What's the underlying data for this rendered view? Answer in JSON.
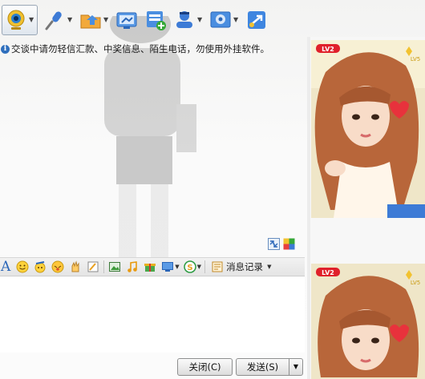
{
  "notice": {
    "text": "交谈中请勿轻信汇款、中奖信息、陌生电话，勿使用外挂软件。"
  },
  "toolbar": {
    "items": [
      {
        "icon": "webcam-icon",
        "has_dropdown": true
      },
      {
        "icon": "microphone-icon",
        "has_dropdown": true
      },
      {
        "icon": "folder-share-icon",
        "has_dropdown": true
      },
      {
        "icon": "screen-share-icon",
        "has_dropdown": false
      },
      {
        "icon": "add-app-icon",
        "has_dropdown": false
      },
      {
        "icon": "group-chat-icon",
        "has_dropdown": true
      },
      {
        "icon": "settings-icon",
        "has_dropdown": true
      },
      {
        "icon": "remote-assist-icon",
        "has_dropdown": false
      }
    ]
  },
  "format_toolbar": {
    "font_glyph": "A",
    "history_label": "消息记录"
  },
  "actions": {
    "close_label": "关闭(C)",
    "send_label": "发送(S)",
    "send_dropdown_glyph": "▼"
  },
  "profiles": {
    "top": {
      "level_badge": "LV2",
      "level_badge_right": "LV5"
    },
    "bottom": {
      "level_badge": "LV2",
      "level_badge_right": "LV5"
    }
  },
  "colors": {
    "accent_blue": "#2a66b8",
    "info_blue": "#2f6fbd",
    "badge_red": "#e0202a",
    "heart_red": "#e8323c"
  }
}
